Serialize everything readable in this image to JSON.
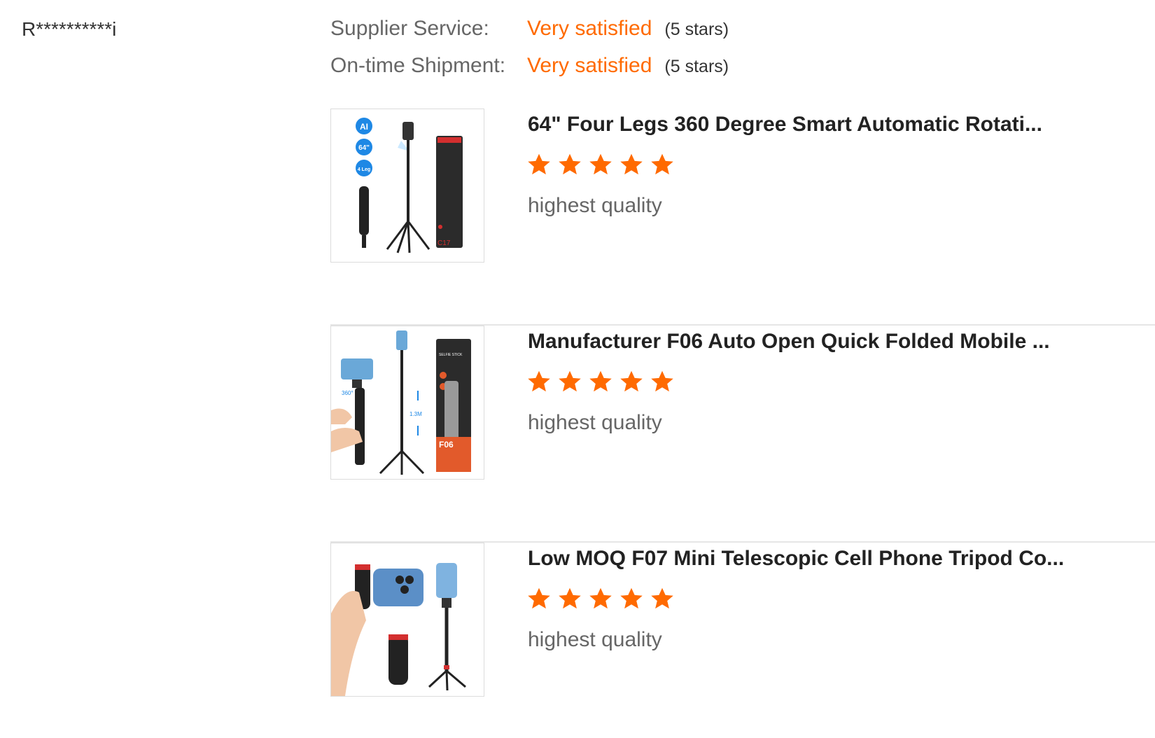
{
  "reviewer": {
    "name": "R**********i"
  },
  "ratings": [
    {
      "label": "Supplier Service:",
      "value": "Very satisfied",
      "stars_text": "(5 stars)",
      "stars": 5
    },
    {
      "label": "On-time Shipment:",
      "value": "Very satisfied",
      "stars_text": "(5 stars)",
      "stars": 5
    }
  ],
  "products": [
    {
      "title": "64\" Four Legs 360 Degree Smart Automatic Rotati...",
      "rating": 5,
      "comment": "highest quality",
      "thumb_badges": [
        "AI",
        "64\"",
        "4 Leg"
      ],
      "box_label": "C17",
      "icon": "tripod-product-image"
    },
    {
      "title": "Manufacturer F06 Auto Open Quick Folded Mobile ...",
      "rating": 5,
      "comment": "highest quality",
      "thumb_labels": [
        "360°",
        "1.3M",
        "SELFIE STICK",
        "F06"
      ],
      "icon": "selfie-stick-product-image"
    },
    {
      "title": "Low MOQ F07 Mini Telescopic Cell Phone Tripod Co...",
      "rating": 5,
      "comment": "highest quality",
      "icon": "mini-tripod-product-image"
    }
  ],
  "colors": {
    "accent": "#ff6a00",
    "text": "#333333",
    "muted": "#666666",
    "divider": "#e6e6e6"
  }
}
